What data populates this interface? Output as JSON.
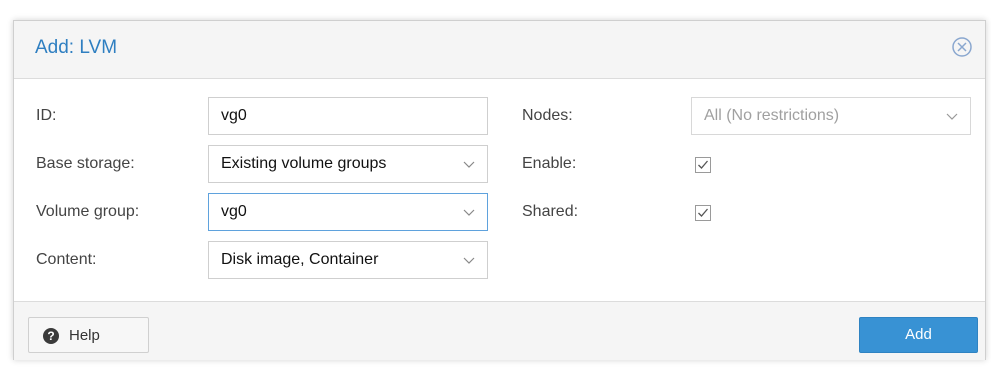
{
  "dialog": {
    "title": "Add: LVM",
    "close_icon": "close-circle-icon"
  },
  "form": {
    "left": {
      "id_label": "ID:",
      "id_value": "vg0",
      "base_storage_label": "Base storage:",
      "base_storage_value": "Existing volume groups",
      "volume_group_label": "Volume group:",
      "volume_group_value": "vg0",
      "content_label": "Content:",
      "content_value": "Disk image, Container"
    },
    "right": {
      "nodes_label": "Nodes:",
      "nodes_placeholder": "All (No restrictions)",
      "enable_label": "Enable:",
      "enable_checked": true,
      "shared_label": "Shared:",
      "shared_checked": true
    }
  },
  "footer": {
    "help_icon": "question-circle-icon",
    "help_label": "Help",
    "add_label": "Add"
  },
  "colors": {
    "title": "#2f7fc1",
    "primary_button": "#3892d4",
    "focus_border": "#5fa2dd"
  }
}
